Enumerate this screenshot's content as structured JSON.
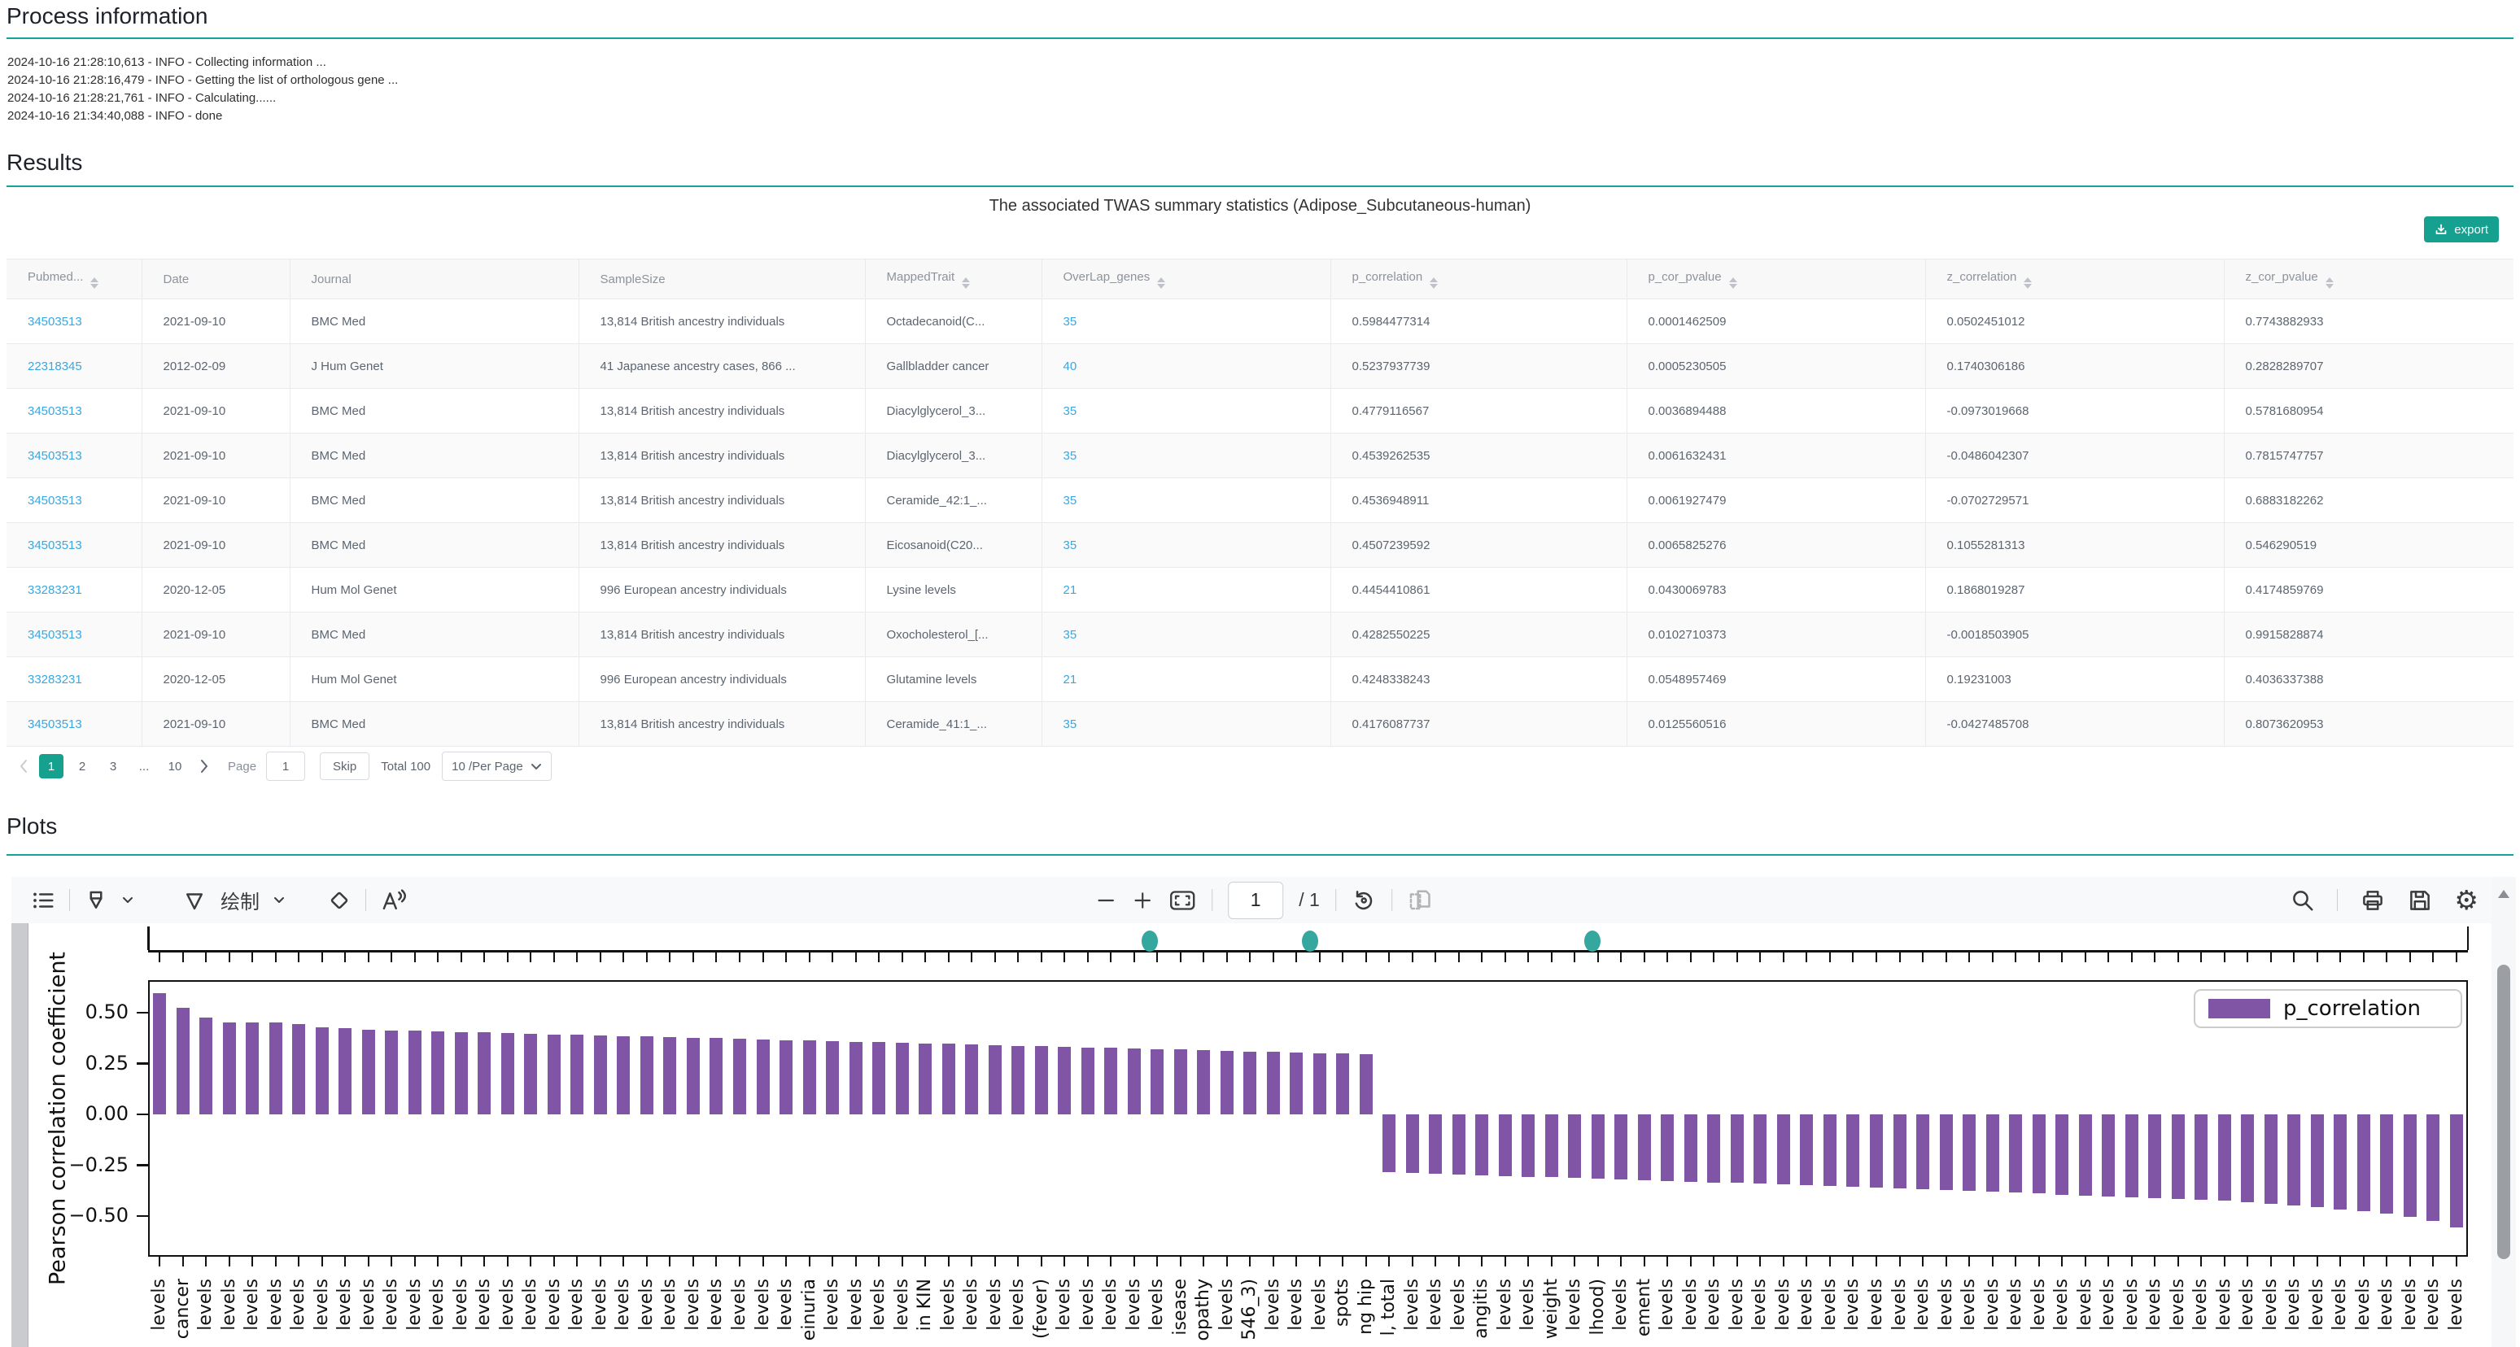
{
  "process": {
    "title": "Process information",
    "log_lines": [
      "2024-10-16 21:28:10,613 - INFO - Collecting information ...",
      "2024-10-16 21:28:16,479 - INFO - Getting the list of orthologous gene ...",
      "2024-10-16 21:28:21,761 - INFO - Calculating......",
      "2024-10-16 21:34:40,088 - INFO - done"
    ]
  },
  "results": {
    "title": "Results",
    "table_title": "The associated TWAS summary statistics (Adipose_Subcutaneous-human)",
    "export_label": "export",
    "columns": [
      {
        "label": "Pubmed...",
        "sortable": true
      },
      {
        "label": "Date",
        "sortable": false
      },
      {
        "label": "Journal",
        "sortable": false
      },
      {
        "label": "SampleSize",
        "sortable": false
      },
      {
        "label": "MappedTrait",
        "sortable": true
      },
      {
        "label": "OverLap_genes",
        "sortable": true
      },
      {
        "label": "p_correlation",
        "sortable": true
      },
      {
        "label": "p_cor_pvalue",
        "sortable": true
      },
      {
        "label": "z_correlation",
        "sortable": true
      },
      {
        "label": "z_cor_pvalue",
        "sortable": true
      }
    ],
    "rows": [
      {
        "pubmed": "34503513",
        "date": "2021-09-10",
        "journal": "BMC Med",
        "sample_size": "13,814 British ancestry individuals",
        "mapped_trait": "Octadecanoid(C...",
        "overlap_genes": "35",
        "p_correlation": "0.5984477314",
        "p_cor_pvalue": "0.0001462509",
        "z_correlation": "0.0502451012",
        "z_cor_pvalue": "0.7743882933"
      },
      {
        "pubmed": "22318345",
        "date": "2012-02-09",
        "journal": "J Hum Genet",
        "sample_size": "41 Japanese ancestry cases, 866 ...",
        "mapped_trait": "Gallbladder cancer",
        "overlap_genes": "40",
        "p_correlation": "0.5237937739",
        "p_cor_pvalue": "0.0005230505",
        "z_correlation": "0.1740306186",
        "z_cor_pvalue": "0.2828289707"
      },
      {
        "pubmed": "34503513",
        "date": "2021-09-10",
        "journal": "BMC Med",
        "sample_size": "13,814 British ancestry individuals",
        "mapped_trait": "Diacylglycerol_3...",
        "overlap_genes": "35",
        "p_correlation": "0.4779116567",
        "p_cor_pvalue": "0.0036894488",
        "z_correlation": "-0.0973019668",
        "z_cor_pvalue": "0.5781680954"
      },
      {
        "pubmed": "34503513",
        "date": "2021-09-10",
        "journal": "BMC Med",
        "sample_size": "13,814 British ancestry individuals",
        "mapped_trait": "Diacylglycerol_3...",
        "overlap_genes": "35",
        "p_correlation": "0.4539262535",
        "p_cor_pvalue": "0.0061632431",
        "z_correlation": "-0.0486042307",
        "z_cor_pvalue": "0.7815747757"
      },
      {
        "pubmed": "34503513",
        "date": "2021-09-10",
        "journal": "BMC Med",
        "sample_size": "13,814 British ancestry individuals",
        "mapped_trait": "Ceramide_42:1_...",
        "overlap_genes": "35",
        "p_correlation": "0.4536948911",
        "p_cor_pvalue": "0.0061927479",
        "z_correlation": "-0.0702729571",
        "z_cor_pvalue": "0.6883182262"
      },
      {
        "pubmed": "34503513",
        "date": "2021-09-10",
        "journal": "BMC Med",
        "sample_size": "13,814 British ancestry individuals",
        "mapped_trait": "Eicosanoid(C20...",
        "overlap_genes": "35",
        "p_correlation": "0.4507239592",
        "p_cor_pvalue": "0.0065825276",
        "z_correlation": "0.1055281313",
        "z_cor_pvalue": "0.546290519"
      },
      {
        "pubmed": "33283231",
        "date": "2020-12-05",
        "journal": "Hum Mol Genet",
        "sample_size": "996 European ancestry individuals",
        "mapped_trait": "Lysine levels",
        "overlap_genes": "21",
        "p_correlation": "0.4454410861",
        "p_cor_pvalue": "0.0430069783",
        "z_correlation": "0.1868019287",
        "z_cor_pvalue": "0.4174859769"
      },
      {
        "pubmed": "34503513",
        "date": "2021-09-10",
        "journal": "BMC Med",
        "sample_size": "13,814 British ancestry individuals",
        "mapped_trait": "Oxocholesterol_[...",
        "overlap_genes": "35",
        "p_correlation": "0.4282550225",
        "p_cor_pvalue": "0.0102710373",
        "z_correlation": "-0.0018503905",
        "z_cor_pvalue": "0.9915828874"
      },
      {
        "pubmed": "33283231",
        "date": "2020-12-05",
        "journal": "Hum Mol Genet",
        "sample_size": "996 European ancestry individuals",
        "mapped_trait": "Glutamine levels",
        "overlap_genes": "21",
        "p_correlation": "0.4248338243",
        "p_cor_pvalue": "0.0548957469",
        "z_correlation": "0.19231003",
        "z_cor_pvalue": "0.4036337388"
      },
      {
        "pubmed": "34503513",
        "date": "2021-09-10",
        "journal": "BMC Med",
        "sample_size": "13,814 British ancestry individuals",
        "mapped_trait": "Ceramide_41:1_...",
        "overlap_genes": "35",
        "p_correlation": "0.4176087737",
        "p_cor_pvalue": "0.0125560516",
        "z_correlation": "-0.0427485708",
        "z_cor_pvalue": "0.8073620953"
      }
    ],
    "pagination": {
      "pages": [
        "1",
        "2",
        "3",
        "...",
        "10"
      ],
      "active_page": "1",
      "page_label": "Page",
      "page_value": "1",
      "skip_label": "Skip",
      "total_label": "Total 100",
      "per_page_label": "10 /Per Page"
    }
  },
  "plots": {
    "title": "Plots",
    "toolbar": {
      "draw_label": "绘制",
      "page_value": "1",
      "page_count_label": "/ 1"
    }
  },
  "chart_data": {
    "type": "bar",
    "title": "",
    "xlabel": "",
    "ylabel": "Pearson correlation coefficient",
    "legend": [
      {
        "label": "p_correlation",
        "color": "#8155a6"
      }
    ],
    "legend_position": "upper right",
    "grid": false,
    "bar_color": "#8155a6",
    "ylim": [
      -0.69,
      0.66
    ],
    "yticks": [
      {
        "value": 0.5,
        "label": "0.50"
      },
      {
        "value": 0.25,
        "label": "0.25"
      },
      {
        "value": 0.0,
        "label": "0.00"
      },
      {
        "value": -0.25,
        "label": "−0.25"
      },
      {
        "value": -0.5,
        "label": "−0.50"
      }
    ],
    "categories": [
      "levels",
      "cancer",
      "levels",
      "levels",
      "levels",
      "levels",
      "levels",
      "levels",
      "levels",
      "levels",
      "levels",
      "levels",
      "levels",
      "levels",
      "levels",
      "levels",
      "levels",
      "levels",
      "levels",
      "levels",
      "levels",
      "levels",
      "levels",
      "levels",
      "levels",
      "levels",
      "levels",
      "levels",
      "einuria",
      "levels",
      "levels",
      "levels",
      "levels",
      "in KIN",
      "levels",
      "levels",
      "levels",
      "levels",
      "(fever)",
      "levels",
      "levels",
      "levels",
      "levels",
      "levels",
      "isease",
      "opathy",
      "levels",
      "546_3)",
      "levels",
      "levels",
      "levels",
      "spots",
      "ng hip",
      "l, total",
      "levels",
      "levels",
      "levels",
      "angitis",
      "levels",
      "levels",
      "weight",
      "levels",
      "lhood)",
      "levels",
      "ement",
      "levels",
      "levels",
      "levels",
      "levels",
      "levels",
      "levels",
      "levels",
      "levels",
      "levels",
      "levels",
      "levels",
      "levels",
      "levels",
      "levels",
      "levels",
      "levels",
      "levels",
      "levels",
      "levels",
      "levels",
      "levels",
      "levels",
      "levels",
      "levels",
      "levels",
      "levels",
      "levels",
      "levels",
      "levels",
      "levels",
      "levels",
      "levels",
      "levels",
      "levels",
      "levels"
    ],
    "values": [
      0.598,
      0.524,
      0.478,
      0.454,
      0.454,
      0.451,
      0.445,
      0.428,
      0.425,
      0.418,
      0.414,
      0.411,
      0.408,
      0.405,
      0.403,
      0.4,
      0.397,
      0.394,
      0.391,
      0.389,
      0.386,
      0.383,
      0.38,
      0.377,
      0.375,
      0.372,
      0.369,
      0.366,
      0.363,
      0.361,
      0.358,
      0.355,
      0.352,
      0.349,
      0.347,
      0.344,
      0.341,
      0.338,
      0.335,
      0.333,
      0.33,
      0.327,
      0.324,
      0.321,
      0.319,
      0.316,
      0.313,
      0.31,
      0.307,
      0.305,
      0.302,
      0.299,
      0.296,
      -0.285,
      -0.288,
      -0.292,
      -0.295,
      -0.299,
      -0.302,
      -0.306,
      -0.309,
      -0.313,
      -0.316,
      -0.32,
      -0.323,
      -0.327,
      -0.33,
      -0.334,
      -0.337,
      -0.341,
      -0.344,
      -0.348,
      -0.351,
      -0.355,
      -0.358,
      -0.362,
      -0.367,
      -0.371,
      -0.376,
      -0.38,
      -0.385,
      -0.389,
      -0.394,
      -0.398,
      -0.403,
      -0.407,
      -0.412,
      -0.416,
      -0.421,
      -0.425,
      -0.432,
      -0.44,
      -0.448,
      -0.457,
      -0.466,
      -0.476,
      -0.488,
      -0.505,
      -0.525,
      -0.555
    ],
    "clipped_plot_above": {
      "marker_color": "#35a79e",
      "markers_x_px": [
        1399,
        1596,
        1943
      ]
    }
  },
  "colors": {
    "accent_teal": "#14a299",
    "link_blue": "#3aa7e0",
    "active_page_bg": "#16a08e",
    "bar_purple": "#8155a6"
  }
}
